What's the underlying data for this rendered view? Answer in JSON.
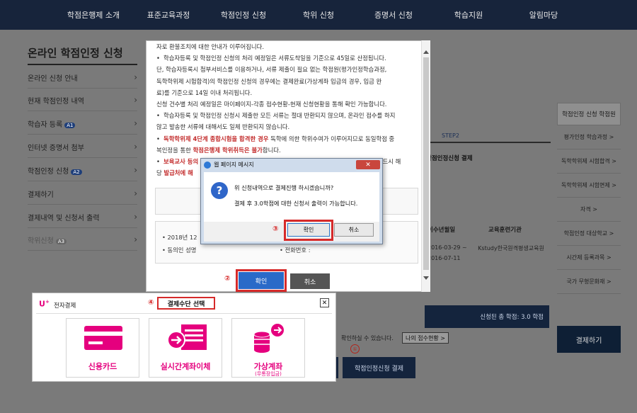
{
  "nav": [
    "학점은행제 소개",
    "표준교육과정",
    "학점인정 신청",
    "학위 신청",
    "증명서 신청",
    "학습지원",
    "알림마당"
  ],
  "sidebar": {
    "title": "온라인 학점인정 신청",
    "items": [
      {
        "label": "온라인 신청 안내",
        "badge": ""
      },
      {
        "label": "현재 학점인정 내역",
        "badge": ""
      },
      {
        "label": "학습자 등록",
        "badge": "A1"
      },
      {
        "label": "인터넷 증명서 첨부",
        "badge": ""
      },
      {
        "label": "학점인정 신청",
        "badge": "A2"
      },
      {
        "label": "결제하기",
        "badge": ""
      },
      {
        "label": "결제내역 및 신청서 출력",
        "badge": ""
      },
      {
        "label": "학위신청",
        "badge": "A3"
      }
    ]
  },
  "right_panel": {
    "header": "학점인정 신청 학점원",
    "items": [
      "평가인정 학습과정 >",
      "독학학위제 시험합격 >",
      "독학학위제 시험면제 >",
      "자격 >",
      "학점인정 대상학교 >",
      "시간제 등록과목 >",
      "국가 무형문화재 >"
    ],
    "pay_button": "결제하기"
  },
  "background": {
    "step": "STEP2",
    "step_title": "학점인정신청 결제",
    "th_date": "이수년월일",
    "th_org": "교육훈련기관",
    "date_from": "2016-03-29 ~",
    "date_to": "2016-07-11",
    "org": "Kstudy한국원격평생교육원",
    "total": "신청된 총 학점: 3.0 학점",
    "check_text": "확인하실 수 있습니다.",
    "check_btn": "나의 접수현황 >",
    "circle": "①",
    "apply_btn": "학점인정신청 결제"
  },
  "modal": {
    "lines": [
      {
        "type": "plain",
        "text": "자로 환불조치에 대한 안내가 이루어집니다."
      },
      {
        "type": "bullet",
        "text": "학습자등록 및 학점인정 신청의 처리 예정일은 서류도착일을 기준으로 45일로 산정됩니다."
      },
      {
        "type": "plain",
        "text": "단, 학습자등록시 첨부서비스를 이용하거나, 서류 제출이 필요 없는 학점원(평가인정학습과정,"
      },
      {
        "type": "plain",
        "text": "독학학위제 시험합격)의 학점인정 신청의 경우에는 결제완료(가상계좌 입금의 경우, 입금 완"
      },
      {
        "type": "plain",
        "text": "료)를 기준으로 14일 이내 처리됩니다."
      },
      {
        "type": "plain",
        "text": "신청 건수별 처리 예정일은 마이페이지-각종 접수현황-현재 신청현황을 통해 확인 가능합니다."
      },
      {
        "type": "bullet",
        "text": "학습자등록 및 학점인정 신청시 제출한 모든 서류는 절대 반환되지 않으며, 온라인 접수를 하지"
      },
      {
        "type": "plain",
        "text": "않고 발송한 서류에 대해서도 일체 반환되지 않습니다."
      }
    ],
    "red_line1_a": "독학학위제 4단계 종합시험을 합격한 경우",
    "red_line1_b": " 독학에 의한 학위수여가 이루어지므로 동일학점 중",
    "red_line2_a": "복인정을 통한 ",
    "red_line2_b": "학점은행제 학위취득은 불가",
    "red_line2_c": "합니다.",
    "red_line3_a": "보육교사 등의",
    "red_line3_b": " 반드시 해",
    "red_line4_a": "당 ",
    "red_line4_b": "발급처에 해",
    "info_date": "2018년 12",
    "info_name": "동의인 성명",
    "info_phone": "전화번호 :",
    "ok": "확인",
    "cancel": "취소",
    "num2": "②"
  },
  "dialog": {
    "title": "웹 페이지 메시지",
    "msg1": "위 신청내역으로 결제진행 하시겠습니까?",
    "msg2": "결제 후 3.0학점에 대한 신청서 출력이 가능합니다.",
    "ok": "확인",
    "cancel": "취소",
    "num3": "③"
  },
  "payment": {
    "logo": "U",
    "logo_sup": "+",
    "logo_text": "전자결제",
    "num4": "④",
    "title": "결제수단 선택",
    "options": [
      {
        "label": "신용카드",
        "sub": ""
      },
      {
        "label": "실시간계좌이체",
        "sub": ""
      },
      {
        "label": "가상계좌",
        "sub": "(무통장입금)"
      }
    ]
  },
  "colors": {
    "accent_pink": "#e5007e",
    "highlight_red": "#d62a2a",
    "nav_bg": "#17243b"
  }
}
